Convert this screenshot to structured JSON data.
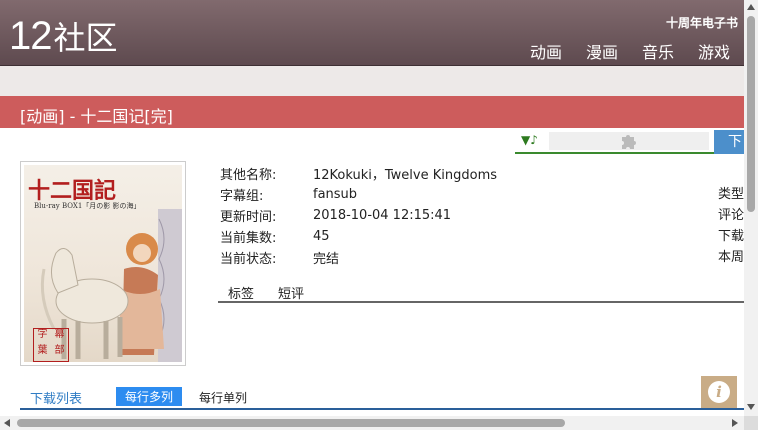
{
  "header": {
    "logo_number": "12",
    "logo_text": "社区",
    "anniversary_link": "十周年电子书",
    "nav": [
      "动画",
      "漫画",
      "音乐",
      "游戏"
    ]
  },
  "title_bar": {
    "text": "[动画] - 十二国记[完]"
  },
  "player": {
    "music_icon": "▼♪",
    "plugin_icon": "puzzle-piece-icon"
  },
  "download_button": {
    "label": "下"
  },
  "cover": {
    "title": "十二国記",
    "subtitle": "Blu-ray BOX1「月の影 影の海」",
    "stamp": [
      "字",
      "幕",
      "葉",
      "部"
    ]
  },
  "details": [
    {
      "label": "其他名称:",
      "value": "12Kokuki，Twelve Kingdoms"
    },
    {
      "label": "字幕组:",
      "value": "fansub"
    },
    {
      "label": "更新时间:",
      "value": "2018-10-04 12:15:41"
    },
    {
      "label": "当前集数:",
      "value": "45"
    },
    {
      "label": "当前状态:",
      "value": "完结"
    }
  ],
  "right_labels": [
    "类型",
    "评论",
    "下载",
    "本周"
  ],
  "subtabs": [
    "标签",
    "短评"
  ],
  "download_tabs": {
    "list": "下载列表",
    "multi": "每行多列",
    "single": "每行单列"
  },
  "info_button": {
    "icon": "info-icon",
    "glyph": "i"
  },
  "colors": {
    "header": "#6f5a5e",
    "title_bar": "#cd5c5c",
    "accent_blue": "#2d8cf0",
    "info_button": "#c9ac86"
  }
}
